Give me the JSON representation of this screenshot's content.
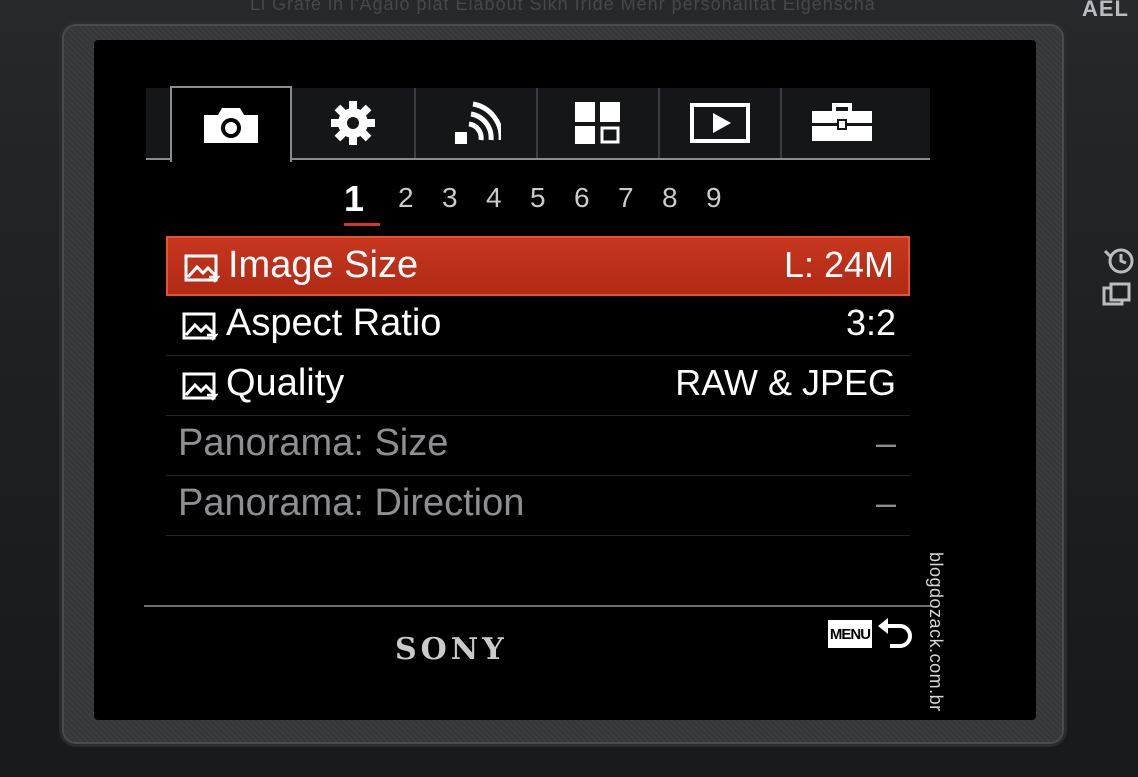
{
  "camera": {
    "top_text": "Li Grafe in l'Agalo plat Elabout Sikh Iride Mehr personalität Eigenscha",
    "ael_label": "AEL",
    "brand": "SONY",
    "watermark": "blogdozack.com.br"
  },
  "tabs": [
    {
      "icon": "camera-icon",
      "active": true
    },
    {
      "icon": "gear-icon",
      "active": false
    },
    {
      "icon": "wireless-icon",
      "active": false
    },
    {
      "icon": "grid-icon",
      "active": false
    },
    {
      "icon": "playback-icon",
      "active": false
    },
    {
      "icon": "toolbox-icon",
      "active": false
    }
  ],
  "pages": [
    "1",
    "2",
    "3",
    "4",
    "5",
    "6",
    "7",
    "8",
    "9"
  ],
  "active_page": "1",
  "menu": {
    "items": [
      {
        "label": "Image Size",
        "value": "L: 24M",
        "selected": true,
        "enabled": true
      },
      {
        "label": "Aspect Ratio",
        "value": "3:2",
        "selected": false,
        "enabled": true
      },
      {
        "label": "Quality",
        "value": "RAW & JPEG",
        "selected": false,
        "enabled": true
      },
      {
        "label": "Panorama: Size",
        "value": "–",
        "selected": false,
        "enabled": false
      },
      {
        "label": "Panorama: Direction",
        "value": "–",
        "selected": false,
        "enabled": false
      }
    ]
  },
  "footer": {
    "menu_badge": "MENU",
    "back_icon": "return-icon"
  },
  "colors": {
    "selection": "#c6361f",
    "selection_border": "#e8522f",
    "page_underline": "#d9342b",
    "text_enabled": "#ffffff",
    "text_disabled": "#8d8f92"
  }
}
